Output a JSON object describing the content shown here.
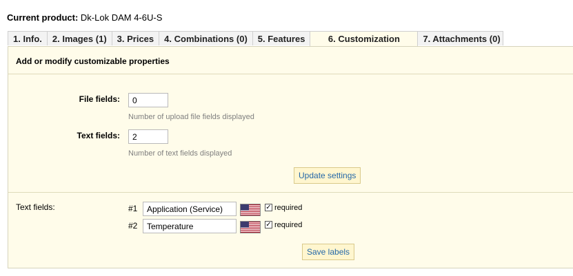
{
  "header": {
    "current_label": "Current product:",
    "product_name": "Dk-Lok DAM 4-6U-S"
  },
  "tabs": [
    {
      "label": "1. Info."
    },
    {
      "label": "2. Images (1)"
    },
    {
      "label": "3. Prices"
    },
    {
      "label": "4. Combinations (0)"
    },
    {
      "label": "5. Features"
    },
    {
      "label": "6. Customization",
      "active": true
    },
    {
      "label": "7. Attachments (0)"
    }
  ],
  "panel": {
    "legend": "Add or modify customizable properties",
    "file_fields": {
      "label": "File fields:",
      "value": "0",
      "hint": "Number of upload file fields displayed"
    },
    "text_fields": {
      "label": "Text fields:",
      "value": "2",
      "hint": "Number of text fields displayed"
    },
    "update_button": "Update settings",
    "labels_section": {
      "title": "Text fields:",
      "rows": [
        {
          "num": "#1",
          "value": "Application (Service)",
          "flag": "us-flag-icon",
          "required_checked": true,
          "required_label": "required"
        },
        {
          "num": "#2",
          "value": "Temperature",
          "flag": "us-flag-icon",
          "required_checked": true,
          "required_label": "required"
        }
      ]
    },
    "save_button": "Save labels"
  },
  "colors": {
    "panel_bg": "#fffcea",
    "button_text": "#2468a8",
    "hint_text": "#7f7f7f"
  }
}
